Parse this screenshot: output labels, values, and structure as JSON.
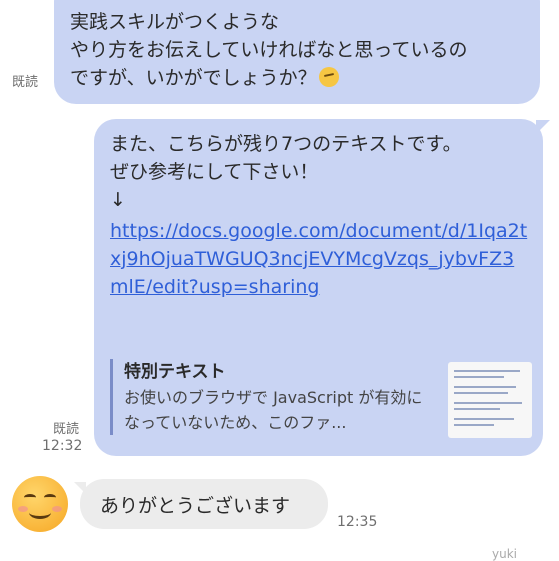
{
  "messages": {
    "msg1": {
      "text": "実践スキルがつくような\nやり方をお伝えしていければなと思っているの\nですが、いかがでしょうか？",
      "emoji": "thinking-face-emoji",
      "status": "既読"
    },
    "msg2": {
      "text": "また、こちらが残り7つのテキストです。\nぜひ参考にして下さい！\n↓",
      "link": "https://docs.google.com/document/d/1Iqa2txj9hOjuaTWGUQ3ncjEVYMcgVzqs_jybvFZ3mlE/edit?usp=sharing",
      "preview": {
        "title": "特別テキスト",
        "description": "お使いのブラウザで JavaScript が有効になっていないため、このファ..."
      },
      "status": "既読",
      "time": "12:32"
    },
    "reply": {
      "text": "ありがとうございます",
      "time": "12:35",
      "avatar": "smiling-face-emoji"
    }
  },
  "watermark": "yuki",
  "colors": {
    "outgoing_bubble": "#c9d4f3",
    "incoming_bubble": "#ececec",
    "link": "#2f5fd8"
  }
}
